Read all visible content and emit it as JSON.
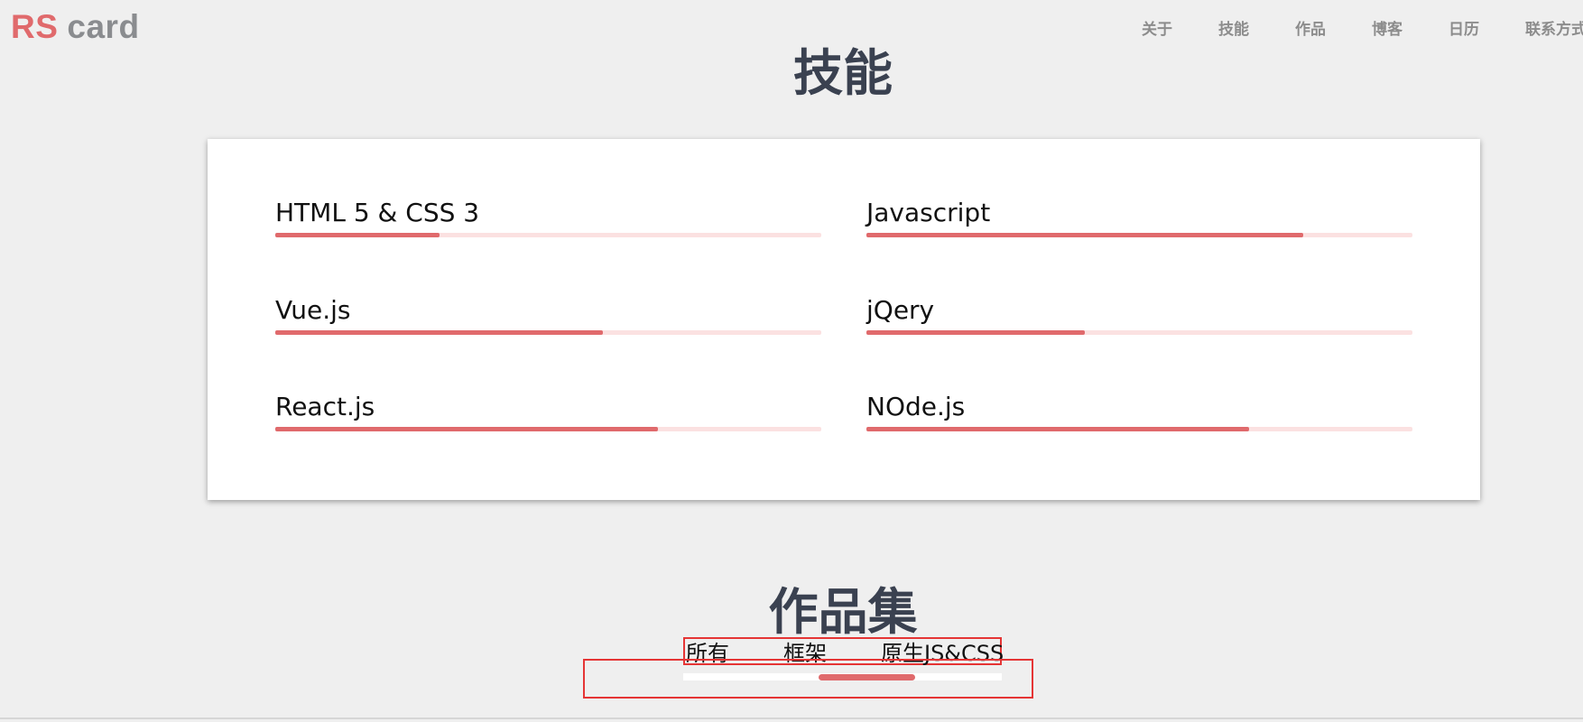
{
  "logo": {
    "rs": "RS",
    "card": "card"
  },
  "nav": {
    "items": [
      "关于",
      "技能",
      "作品",
      "博客",
      "日历",
      "联系方式"
    ]
  },
  "skills": {
    "title": "技能",
    "items": [
      {
        "name": "HTML 5 & CSS 3",
        "level": 0.3
      },
      {
        "name": "Javascript",
        "level": 0.8
      },
      {
        "name": "Vue.js",
        "level": 0.6
      },
      {
        "name": "jQery",
        "level": 0.4
      },
      {
        "name": "React.js",
        "level": 0.7
      },
      {
        "name": "NOde.js",
        "level": 0.7
      }
    ]
  },
  "works": {
    "title": "作品集",
    "tabs": [
      "所有",
      "框架",
      "原生JS&CSS"
    ],
    "active_tab_index": 1
  },
  "colors": {
    "accent": "#e06a6c",
    "track": "#fbe1e1",
    "heading": "#3a4150",
    "background": "#efefef"
  }
}
